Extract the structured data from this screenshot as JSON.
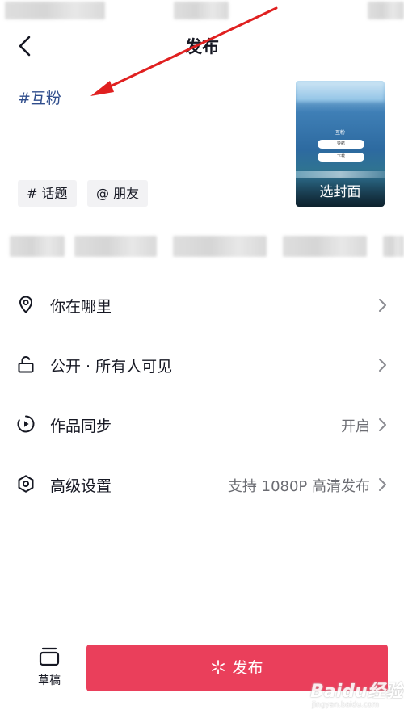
{
  "nav": {
    "title": "发布"
  },
  "caption": "#互粉",
  "cover": {
    "label": "选封面",
    "mini_title": "互粉",
    "mini_buttons": [
      "导航",
      "下载"
    ]
  },
  "chips": {
    "topic": "# 话题",
    "friend": "@ 朋友"
  },
  "rows": [
    {
      "label": "你在哪里",
      "value": "",
      "icon": "location-pin-icon"
    },
    {
      "label": "公开 · 所有人可见",
      "value": "",
      "icon": "unlock-icon"
    },
    {
      "label": "作品同步",
      "value": "开启",
      "icon": "play-sync-icon"
    },
    {
      "label": "高级设置",
      "value": "支持 1080P 高清发布",
      "icon": "hexagon-settings-icon"
    }
  ],
  "bottom": {
    "drafts_label": "草稿",
    "publish_label": "发布"
  },
  "watermark": {
    "brand": "Baidu经验",
    "url": "jingyan.baidu.com"
  },
  "colors": {
    "accent": "#ea3f5b",
    "hashtag": "#2f4d8c",
    "annotation_arrow": "#e02020"
  }
}
